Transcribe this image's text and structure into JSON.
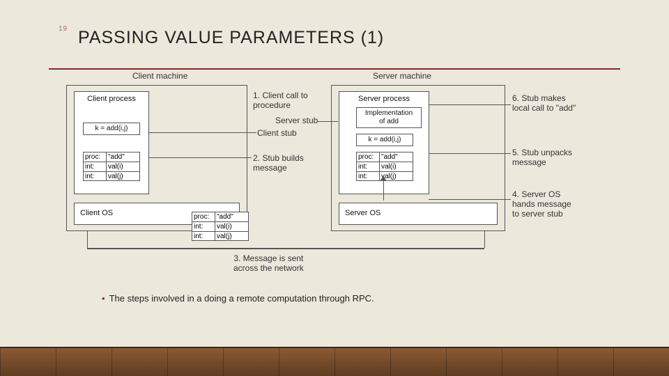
{
  "page_number": "19",
  "title": "PASSING VALUE PARAMETERS (1)",
  "labels": {
    "client_machine": "Client machine",
    "server_machine": "Server machine",
    "client_process": "Client process",
    "server_process": "Server process",
    "client_os": "Client OS",
    "server_os": "Server OS",
    "client_stub": "Client stub",
    "server_stub": "Server stub",
    "call": "k = add(i,j)",
    "impl1": "Implementation",
    "impl2": "of add",
    "call2": "k = add(i,j)"
  },
  "msg_rows": {
    "r1c1": "proc:",
    "r1c2": "\"add\"",
    "r2c1": "int:",
    "r2c2": "val(i)",
    "r3c1": "int:",
    "r3c2": "val(j)"
  },
  "steps": {
    "s1a": "1. Client call to",
    "s1b": "procedure",
    "s2a": "2. Stub builds",
    "s2b": "message",
    "s3a": "3. Message is sent",
    "s3b": "across the network",
    "s4a": "4. Server OS",
    "s4b": "hands message",
    "s4c": "to server stub",
    "s5a": "5. Stub unpacks",
    "s5b": "message",
    "s6a": "6. Stub makes",
    "s6b": "local call to \"add\""
  },
  "bullet": "The steps involved in a doing a remote computation through RPC."
}
